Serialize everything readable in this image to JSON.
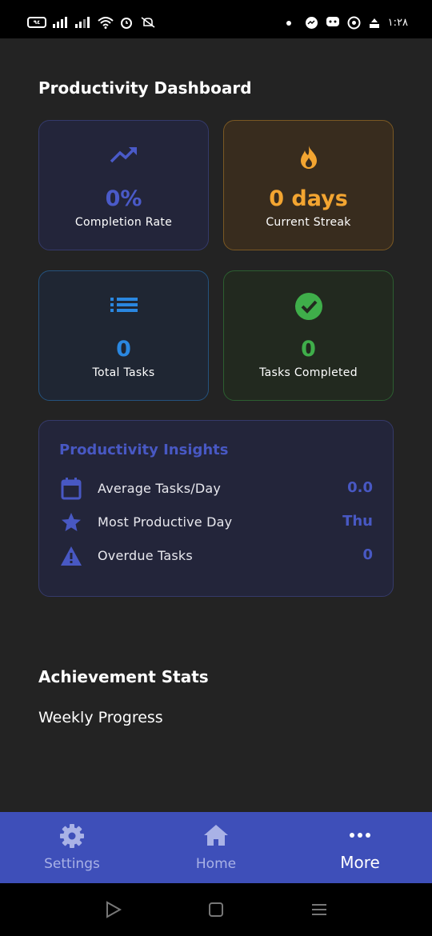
{
  "status_bar": {
    "battery": "٩٤",
    "time": "١:٢٨"
  },
  "page": {
    "title": "Productivity Dashboard"
  },
  "stats": [
    {
      "value": "0%",
      "label": "Completion Rate",
      "icon": "trending-up-icon",
      "color": "#4a5ac8"
    },
    {
      "value": "0 days",
      "label": "Current Streak",
      "icon": "fire-icon",
      "color": "#f3a531"
    },
    {
      "value": "0",
      "label": "Total Tasks",
      "icon": "list-icon",
      "color": "#2a87e0"
    },
    {
      "value": "0",
      "label": "Tasks Completed",
      "icon": "check-circle-icon",
      "color": "#3fae4a"
    }
  ],
  "insights": {
    "title": "Productivity Insights",
    "rows": [
      {
        "label": "Average Tasks/Day",
        "value": "0.0",
        "icon": "calendar-icon"
      },
      {
        "label": "Most Productive Day",
        "value": "Thu",
        "icon": "star-icon"
      },
      {
        "label": "Overdue Tasks",
        "value": "0",
        "icon": "warning-icon"
      }
    ]
  },
  "sections": {
    "achievement": "Achievement Stats",
    "weekly": "Weekly Progress"
  },
  "nav": {
    "items": [
      {
        "label": "Settings",
        "icon": "gear-icon"
      },
      {
        "label": "Home",
        "icon": "home-icon"
      },
      {
        "label": "More",
        "icon": "more-dots-icon"
      }
    ],
    "active": "More"
  },
  "theme": {
    "background": "#232323",
    "accent": "#3e4fb9",
    "insight_accent": "#4858c3"
  }
}
